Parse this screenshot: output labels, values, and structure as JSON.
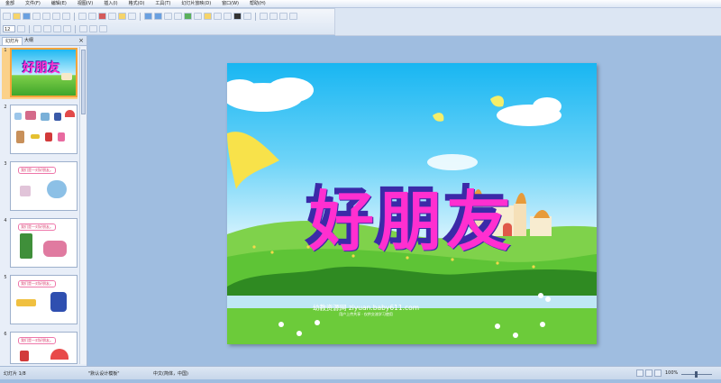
{
  "menu": {
    "items": [
      "文件(F)",
      "编辑(E)",
      "视图(V)",
      "插入(I)",
      "格式(O)",
      "工具(T)",
      "幻灯片放映(D)",
      "窗口(W)",
      "帮助(H)"
    ],
    "first_item": "金部"
  },
  "toolbar": {
    "font_size": "12"
  },
  "panel": {
    "tab_slides": "幻灯片",
    "tab_outline": "大纲",
    "close_label": "×"
  },
  "slides": [
    {
      "number": "1",
      "title": "好朋友",
      "selected": true
    },
    {
      "number": "2",
      "caption": ""
    },
    {
      "number": "3",
      "caption": "我们是一对好朋友。"
    },
    {
      "number": "4",
      "caption": "我们是一对好朋友。"
    },
    {
      "number": "5",
      "caption": "我们是一对好朋友。"
    },
    {
      "number": "6",
      "caption": "我们是一对好朋友。"
    }
  ],
  "slide": {
    "title": "好朋友",
    "watermark": "幼教资源网 ziyuan.baby611.com",
    "watermark_sub": "用户上传共享 · 仅供交流学习使用"
  },
  "status": {
    "slide_count": "幻灯片 1/8",
    "template": "\"默认设计模板\"",
    "language": "中文(简体，中国)",
    "zoom": "100%"
  }
}
